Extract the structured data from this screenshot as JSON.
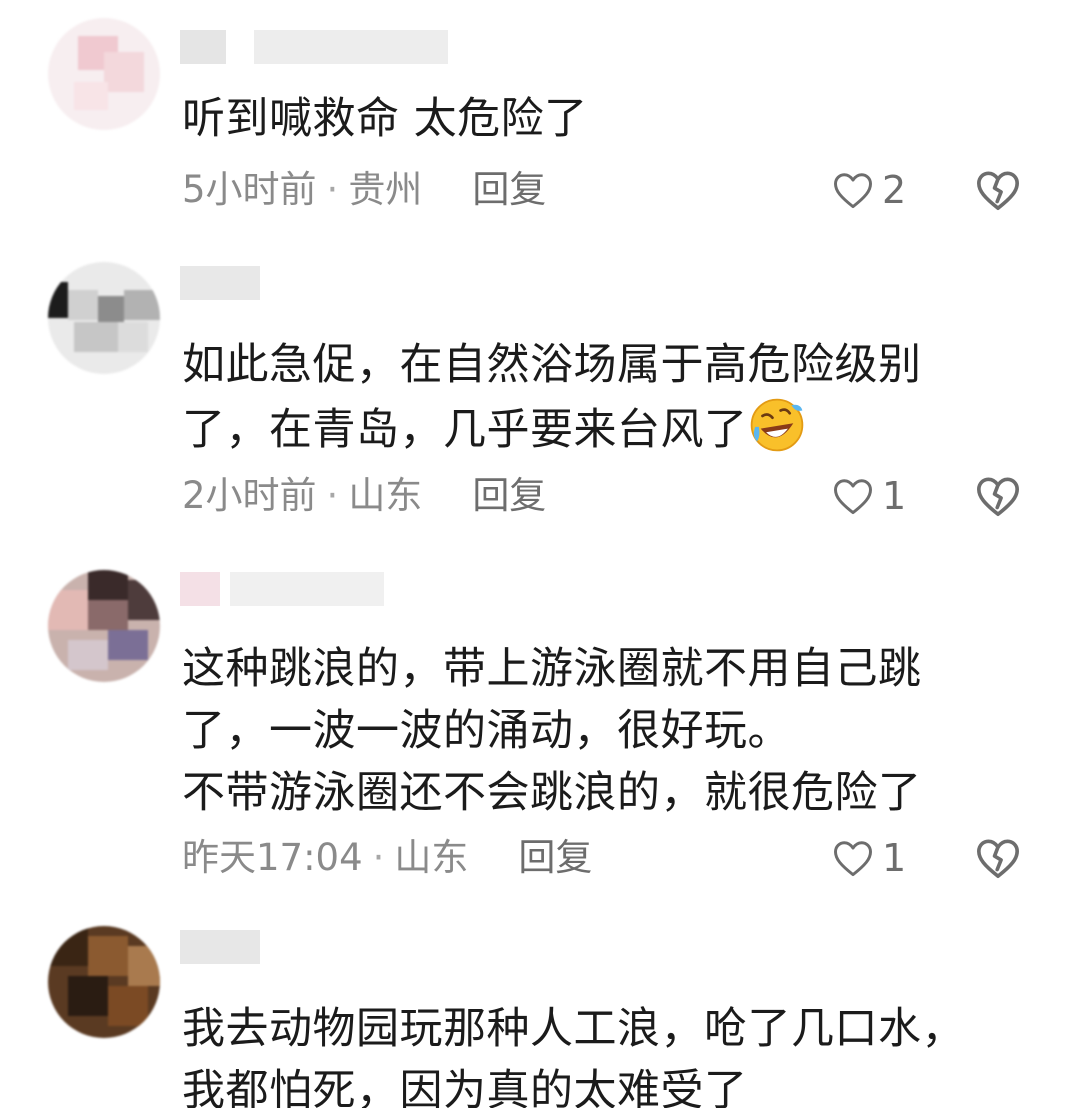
{
  "comments": [
    {
      "content_lines": [
        "听到喊救命 太危险了"
      ],
      "time": "5小时前",
      "location": "贵州",
      "reply_label": "回复",
      "like_count": "2"
    },
    {
      "content_lines": [
        "如此急促，在自然浴场属于高危险级别",
        "了，在青岛，几乎要来台风了"
      ],
      "time": "2小时前",
      "location": "山东",
      "reply_label": "回复",
      "like_count": "1"
    },
    {
      "content_lines": [
        "这种跳浪的，带上游泳圈就不用自己跳",
        "了，一波一波的涌动，很好玩。",
        "不带游泳圈还不会跳浪的，就很危险了"
      ],
      "time": "昨天17:04",
      "location": "山东",
      "reply_label": "回复",
      "like_count": "1"
    },
    {
      "content_lines": [
        "我去动物园玩那种人工浪，呛了几口水，",
        "我都怕死，因为真的太难受了"
      ]
    }
  ],
  "meta_separator": "·",
  "icons": {
    "like": "heart-outline-icon",
    "dislike": "broken-heart-icon",
    "emoji": "rolling-laughing-emoji"
  },
  "colors": {
    "text": "#1b1b1b",
    "meta": "#8a8a8a",
    "icon": "#6d6d6d"
  }
}
